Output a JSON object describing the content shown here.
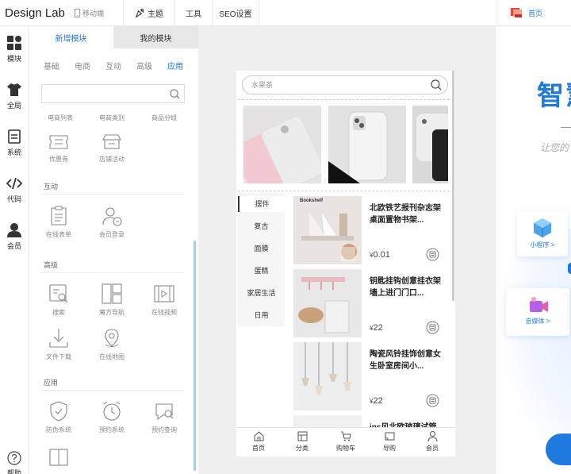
{
  "header": {
    "logo": "Design Lab",
    "mobile_label": "移动端",
    "theme_label": "主题",
    "tools_label": "工具",
    "seo_label": "SEO设置",
    "home_label": "首页"
  },
  "rail": {
    "items": [
      {
        "label": "模块",
        "icon": "grid-icon"
      },
      {
        "label": "全局",
        "icon": "shirt-icon"
      },
      {
        "label": "系统",
        "icon": "list-icon"
      },
      {
        "label": "代码",
        "icon": "code-icon"
      },
      {
        "label": "会员",
        "icon": "user-icon"
      },
      {
        "label": "帮助",
        "icon": "help-icon"
      }
    ]
  },
  "panel": {
    "tabs": [
      "新增模块",
      "我的模块"
    ],
    "categories": [
      "基础",
      "电商",
      "互动",
      "高级",
      "应用"
    ],
    "active_category": "应用",
    "top_items": [
      "电商列表",
      "电商类别",
      "商品分组"
    ],
    "ecom_items": [
      "优惠券",
      "店铺活动"
    ],
    "sections": {
      "interact": {
        "title": "互动",
        "items": [
          "在线表单",
          "会员登录"
        ]
      },
      "advanced": {
        "title": "高级",
        "items": [
          "搜索",
          "魔方导航",
          "在线视频",
          "文件下载",
          "在线地图"
        ]
      },
      "apps": {
        "title": "应用",
        "items": [
          "防伪系统",
          "预约系统",
          "预约查询"
        ]
      }
    }
  },
  "phone": {
    "search_placeholder": "水果茶",
    "categories": [
      "摆件",
      "复古",
      "面膜",
      "蛋糕",
      "家居生活",
      "日用"
    ],
    "active_category": "摆件",
    "book_label": "Bookshelf",
    "products": [
      {
        "title": "北欧铁艺报刊杂志架桌面置物书架...",
        "currency": "¥",
        "price": "0.01"
      },
      {
        "title": "钥匙挂钩创意挂衣架墙上进门门口...",
        "currency": "¥",
        "price": "22"
      },
      {
        "title": "陶瓷风铃挂饰创意女生卧室房间小...",
        "currency": "¥",
        "price": "22"
      },
      {
        "title": "ins风北欧玻璃试管"
      }
    ],
    "tabbar": [
      "首页",
      "分类",
      "购物车",
      "导购",
      "会员"
    ]
  },
  "preview": {
    "title": "智慧",
    "subtitle": "让您的",
    "cards": [
      "小程序 >",
      "自媒体 >"
    ]
  },
  "colors": {
    "accent": "#1f7ae0",
    "home_icon": "#e8453c"
  }
}
